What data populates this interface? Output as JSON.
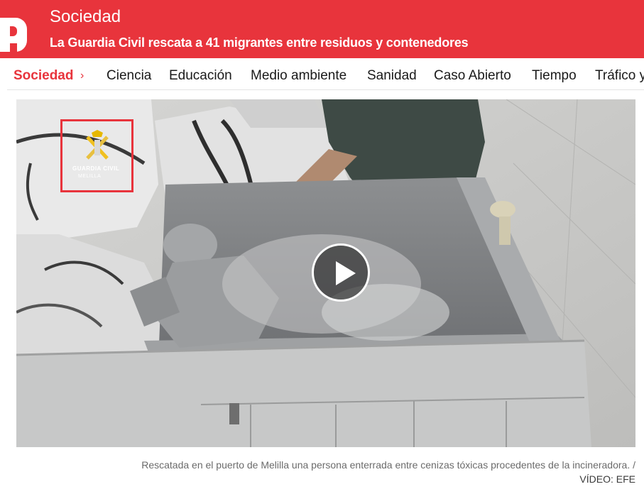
{
  "header": {
    "section": "Sociedad",
    "headline": "La Guardia Civil rescata a 41 migrantes entre residuos y contenedores",
    "brand_color": "#e8343c",
    "logo_icon": "publico-p-logo"
  },
  "nav": {
    "items": [
      {
        "label": "Sociedad",
        "active": true
      },
      {
        "label": "Ciencia"
      },
      {
        "label": "Educación"
      },
      {
        "label": "Medio ambiente"
      },
      {
        "label": "Sanidad"
      },
      {
        "label": "Caso Abierto"
      },
      {
        "label": "Tiempo"
      },
      {
        "label": "Tráfico y"
      }
    ],
    "chevron": "›"
  },
  "video": {
    "watermark_line1": "GUARDIA CIVIL",
    "watermark_line2": "MELILLA",
    "play_icon": "play-icon"
  },
  "caption": {
    "text": "Rescatada en el puerto de Melilla una persona enterrada entre cenizas tóxicas procedentes de la incineradora. /",
    "credit": "VÍDEO: EFE"
  }
}
